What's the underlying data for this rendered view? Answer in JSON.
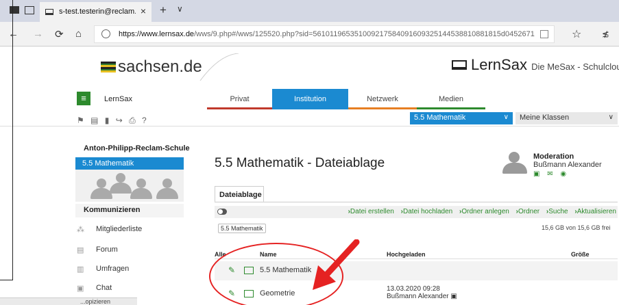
{
  "browser": {
    "tab_title": "s-test.testerin@reclam.l",
    "tab_close": "×",
    "new_tab": "+",
    "tab_menu": "∨",
    "url_domain": "https://www.lernsax.de",
    "url_rest": "/wws/9.php#/wws/125520.php?sid=561011965351009217584091609325144538810881815d0452671",
    "back": "←",
    "forward": "→",
    "refresh": "⟳",
    "home": "⌂",
    "favorite": "☆",
    "hub": "≴"
  },
  "header": {
    "logo_text": "sachsen.de",
    "brand": "LernSax",
    "brand_sub": "Die MeSax - Schulcloud"
  },
  "app": {
    "menu_icon": "≡",
    "name": "LernSax",
    "tools": "⚑ ▤ ▮ ↪ ⎙ ?"
  },
  "tabs": [
    {
      "label": "Privat"
    },
    {
      "label": "Institution"
    },
    {
      "label": "Netzwerk"
    },
    {
      "label": "Medien"
    }
  ],
  "selects": {
    "context": "5.5 Mathematik",
    "group": "Meine Klassen",
    "caret": "∨"
  },
  "sidebar": {
    "school": "Anton-Philipp-Reclam-Schule",
    "class": "5.5 Mathematik",
    "section": "Kommunizieren",
    "items": [
      {
        "label": "Mitgliederliste",
        "icon": "⁂"
      },
      {
        "label": "Forum",
        "icon": "▤"
      },
      {
        "label": "Umfragen",
        "icon": "▥"
      },
      {
        "label": "Chat",
        "icon": "▣"
      }
    ]
  },
  "main": {
    "title": "5.5 Mathematik - Dateiablage",
    "moderation_title": "Moderation",
    "moderator": "Bußmann Alexander",
    "mod_icons": "▣ ✉ ◉",
    "subtab": "Dateiablage",
    "actions": [
      "Datei erstellen",
      "Datei hochladen",
      "Ordner anlegen",
      "Ordner",
      "Suche",
      "Aktualisieren"
    ],
    "breadcrumb": "5.5 Mathematik",
    "quota": "15,6 GB von 15,6 GB frei",
    "columns": {
      "all": "Alle",
      "name": "Name",
      "uploaded": "Hochgeladen",
      "size": "Größe"
    },
    "rows": [
      {
        "name": "5.5 Mathematik",
        "date": "",
        "user": ""
      },
      {
        "name": "Geometrie",
        "date": "13.03.2020 09:28",
        "user": "Bußmann Alexander ▣"
      }
    ]
  },
  "footer_tab": "...opizieren",
  "annotation_color": "#e52222"
}
